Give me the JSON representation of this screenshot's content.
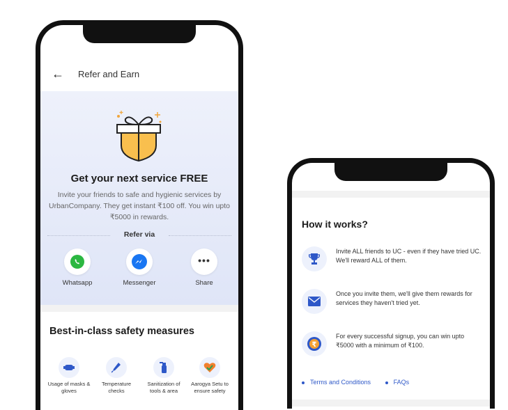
{
  "phone1": {
    "header": {
      "back_icon": "arrow-left-icon",
      "title": "Refer and Earn"
    },
    "hero": {
      "title": "Get your next service FREE",
      "subtitle": "Invite your friends to safe and hygienic services by UrbanCompany. They get instant ₹100 off. You win upto ₹5000 in rewards.",
      "refer_via": "Refer via",
      "share_options": [
        {
          "label": "Whatsapp",
          "icon": "whatsapp-icon"
        },
        {
          "label": "Messenger",
          "icon": "messenger-icon"
        },
        {
          "label": "Share",
          "icon": "more-dots-icon"
        }
      ]
    },
    "safety": {
      "title": "Best-in-class safety measures",
      "items": [
        {
          "label": "Usage of masks & gloves",
          "icon": "mask-icon"
        },
        {
          "label": "Temperature checks",
          "icon": "thermometer-icon"
        },
        {
          "label": "Sanitization of tools & area",
          "icon": "spray-bottle-icon"
        },
        {
          "label": "Aarogya Setu to ensure safety",
          "icon": "heart-shield-icon"
        }
      ]
    }
  },
  "phone2": {
    "how_it_works": {
      "title": "How it works?",
      "steps": [
        {
          "text": "Invite ALL friends to UC - even if they have tried UC. We'll reward ALL of them.",
          "icon": "trophy-icon"
        },
        {
          "text": "Once you invite them, we'll give them rewards for services they haven't tried yet.",
          "icon": "envelope-icon"
        },
        {
          "text": "For every successful signup, you can win upto ₹5000 with a minimum of ₹100.",
          "icon": "rupee-coin-icon"
        }
      ]
    },
    "links": {
      "terms": "Terms and Conditions",
      "faqs": "FAQs"
    }
  },
  "colors": {
    "accent_blue": "#2e58c8",
    "hero_bg": "#e6ebf9",
    "gift_yellow": "#f9bf4e",
    "whatsapp_green": "#2bb741",
    "messenger_blue": "#1976f2"
  }
}
